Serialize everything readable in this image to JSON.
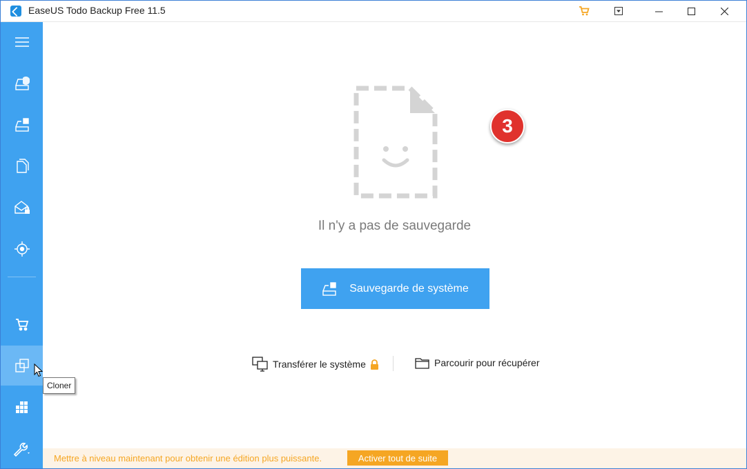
{
  "window": {
    "title": "EaseUS Todo Backup Free 11.5",
    "accent": "#3fa2f0"
  },
  "titlebar": {
    "icons": [
      "cart-icon",
      "dropdown-icon",
      "minimize-icon",
      "maximize-icon",
      "close-icon"
    ]
  },
  "sidebar": {
    "items": [
      {
        "name": "menu",
        "icon": "hamburger-menu-icon"
      },
      {
        "name": "disk-backup",
        "icon": "disk-backup-icon"
      },
      {
        "name": "system-backup",
        "icon": "system-backup-icon"
      },
      {
        "name": "file-backup",
        "icon": "file-backup-icon"
      },
      {
        "name": "mail-backup",
        "icon": "mail-backup-icon"
      },
      {
        "name": "smart-backup",
        "icon": "target-icon"
      },
      {
        "name": "shop",
        "icon": "cart-icon"
      },
      {
        "name": "clone",
        "icon": "clone-icon",
        "active": true
      },
      {
        "name": "tools-grid",
        "icon": "grid-icon"
      },
      {
        "name": "tools",
        "icon": "wrench-icon"
      }
    ]
  },
  "tooltip": {
    "text": "Cloner"
  },
  "main": {
    "step_badge": "3",
    "empty_message": "Il n'y a pas de sauvegarde",
    "primary_button": "Sauvegarde de système",
    "links": {
      "transfer": "Transférer le système",
      "browse": "Parcourir pour récupérer"
    }
  },
  "footer": {
    "message": "Mettre à niveau maintenant pour obtenir une édition plus puissante.",
    "button": "Activer tout de suite",
    "color": "#f5a623"
  }
}
